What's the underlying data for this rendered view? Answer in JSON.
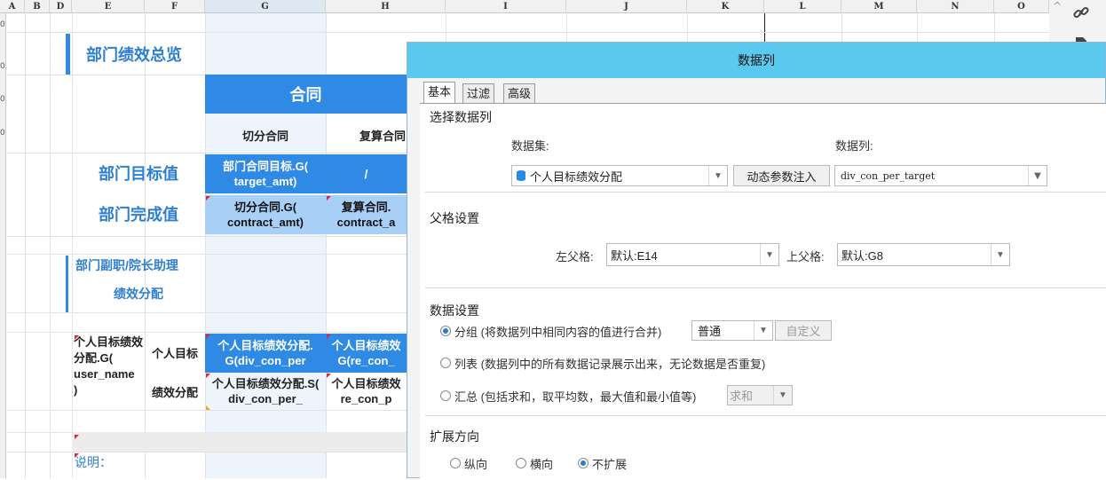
{
  "columns": [
    "A",
    "B",
    "D",
    "E",
    "F",
    "G",
    "H",
    "I",
    "J",
    "K",
    "L",
    "M",
    "N",
    "O"
  ],
  "sheet": {
    "title": "部门绩效总览",
    "contract_header": "合同",
    "col_split": "切分合同",
    "col_recalc": "复算合同",
    "row_target": "部门目标值",
    "row_done": "部门完成值",
    "target_formula": "部门合同目标.G(\ntarget_amt)",
    "slash": "/",
    "done_formula_1": "切分合同.G(\ncontract_amt)",
    "done_formula_2": "复算合同.\ncontract_a",
    "deputy_title": "部门副职/院长助理",
    "deputy_sub": "绩效分配",
    "person_formula": "个人目标绩效分配.G(\nuser_name\n)",
    "label_target": "个人目标",
    "label_alloc": "绩效分配",
    "g_target": "个人目标绩效分配.\nG(div_con_per",
    "h_target": "个人目标绩效\nG(re_con_",
    "g_alloc": "个人目标绩效分配.S(\ndiv_con_per_",
    "h_alloc": "个人目标绩效\nre_con_p",
    "note": "说明：",
    "row_numbers": [
      "0",
      "0",
      "0",
      "0"
    ]
  },
  "sidebar": {
    "icons": [
      "link-icon",
      "file-icon"
    ]
  },
  "dialog": {
    "title": "数据列",
    "tabs": [
      "基本",
      "过滤",
      "高级"
    ],
    "section_select": "选择数据列",
    "dataset_label": "数据集:",
    "column_label": "数据列:",
    "dataset_value": "个人目标绩效分配",
    "dynamic_button": "动态参数注入",
    "column_value": "div_con_per_target",
    "section_parent": "父格设置",
    "left_parent_label": "左父格:",
    "left_parent_value": "默认:E14",
    "top_parent_label": "上父格:",
    "top_parent_value": "默认:G8",
    "section_data": "数据设置",
    "opt_group": "分组 (将数据列中相同内容的值进行合并)",
    "group_mode": "普通",
    "custom_button": "自定义",
    "opt_list": "列表 (数据列中的所有数据记录展示出来，无论数据是否重复)",
    "opt_sum": "汇总 (包括求和，取平均数，最大值和最小值等)",
    "sum_mode": "求和",
    "section_expand": "扩展方向",
    "expand_vertical": "纵向",
    "expand_horizontal": "横向",
    "expand_none": "不扩展"
  },
  "colors": {
    "accent": "#2f8ae6",
    "title_bar": "#5bc8ee",
    "light_cell": "#a8d0f7"
  }
}
